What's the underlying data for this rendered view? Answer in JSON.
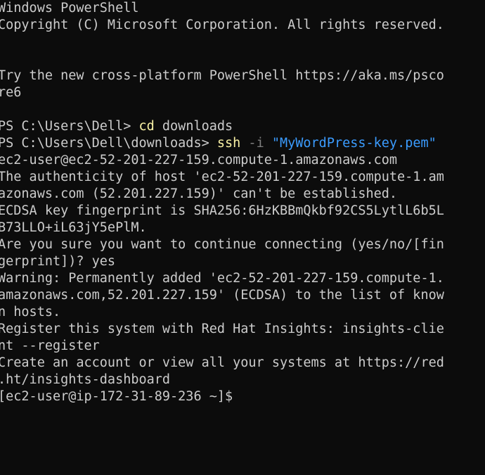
{
  "window": {
    "title": "Windows PowerShell"
  },
  "colors": {
    "background": "#0c0c0c",
    "foreground": "#cccccc",
    "command": "#f9f1a5",
    "parameter": "#808080",
    "string": "#3b9cff"
  },
  "terminal": {
    "banner_title": "Windows PowerShell",
    "copyright": "Copyright (C) Microsoft Corporation. All rights reserved.",
    "tip_line_1": "Try the new cross-platform PowerShell https://aka.ms/psco",
    "tip_line_2": "re6",
    "cmd1": {
      "prompt": "PS C:\\Users\\Dell> ",
      "command": "cd",
      "args": " downloads"
    },
    "cmd2": {
      "prompt": "PS C:\\Users\\Dell\\downloads> ",
      "command": "ssh",
      "param": " -i",
      "space": " ",
      "arg": "\"MyWordPress-key.pem\""
    },
    "out": [
      "ec2-user@ec2-52-201-227-159.compute-1.amazonaws.com",
      "The authenticity of host 'ec2-52-201-227-159.compute-1.am",
      "azonaws.com (52.201.227.159)' can't be established.",
      "ECDSA key fingerprint is SHA256:6HzKBBmQkbf92CS5LytlL6b5L",
      "B73LLO+iL63jY5ePlM.",
      "Are you sure you want to continue connecting (yes/no/[fin",
      "gerprint])? yes",
      "Warning: Permanently added 'ec2-52-201-227-159.compute-1.",
      "amazonaws.com,52.201.227.159' (ECDSA) to the list of know",
      "n hosts.",
      "Register this system with Red Hat Insights: insights-clie",
      "nt --register",
      "Create an account or view all your systems at https://red",
      ".ht/insights-dashboard"
    ],
    "final_prompt": "[ec2-user@ip-172-31-89-236 ~]$"
  }
}
